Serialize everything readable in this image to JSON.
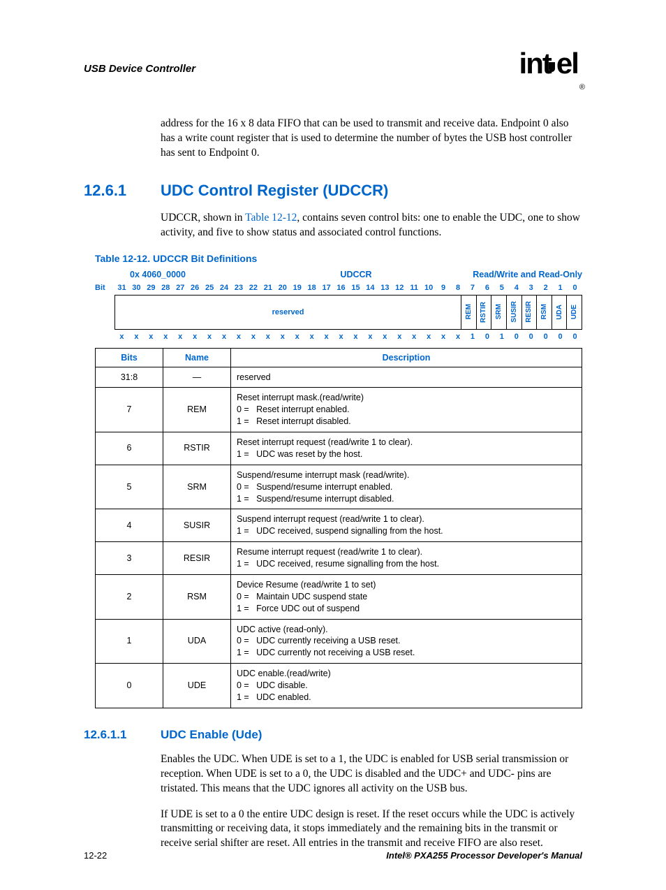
{
  "running_head": "USB Device Controller",
  "logo_text": "intel",
  "intro_para": "address for the 16 x 8 data FIFO that can be used to transmit and receive data. Endpoint 0 also has a write count register that is used to determine the number of bytes the USB host controller has sent to Endpoint 0.",
  "sec": {
    "num": "12.6.1",
    "title": "UDC Control Register (UDCCR)",
    "para_a": "UDCCR, shown in ",
    "para_link": "Table 12-12",
    "para_b": ", contains seven control bits: one to enable the UDC, one to show activity, and five to show status and associated control functions."
  },
  "table_caption": "Table 12-12. UDCCR Bit Definitions",
  "reg": {
    "addr": "0x 4060_0000",
    "name": "UDCCR",
    "access": "Read/Write and Read-Only",
    "bit_label": "Bit",
    "bits": [
      "31",
      "30",
      "29",
      "28",
      "27",
      "26",
      "25",
      "24",
      "23",
      "22",
      "21",
      "20",
      "19",
      "18",
      "17",
      "16",
      "15",
      "14",
      "13",
      "12",
      "11",
      "10",
      "9",
      "8",
      "7",
      "6",
      "5",
      "4",
      "3",
      "2",
      "1",
      "0"
    ],
    "reserved_label": "reserved",
    "fields": [
      "REM",
      "RSTIR",
      "SRM",
      "SUSIR",
      "RESIR",
      "RSM",
      "UDA",
      "UDE"
    ],
    "reset": [
      "x",
      "x",
      "x",
      "x",
      "x",
      "x",
      "x",
      "x",
      "x",
      "x",
      "x",
      "x",
      "x",
      "x",
      "x",
      "x",
      "x",
      "x",
      "x",
      "x",
      "x",
      "x",
      "x",
      "x",
      "1",
      "0",
      "1",
      "0",
      "0",
      "0",
      "0",
      "0"
    ]
  },
  "cols": {
    "bits": "Bits",
    "name": "Name",
    "desc": "Description"
  },
  "rows": [
    {
      "bits": "31:8",
      "name": "—",
      "desc_lines": [
        "reserved"
      ]
    },
    {
      "bits": "7",
      "name": "REM",
      "desc_lines": [
        "Reset interrupt mask.(read/write)",
        "0 =   Reset interrupt enabled.",
        "1 =   Reset interrupt disabled."
      ]
    },
    {
      "bits": "6",
      "name": "RSTIR",
      "desc_lines": [
        "Reset interrupt request (read/write 1 to clear).",
        "1 =   UDC was reset by the host."
      ]
    },
    {
      "bits": "5",
      "name": "SRM",
      "desc_lines": [
        "Suspend/resume interrupt mask (read/write).",
        "0 =   Suspend/resume interrupt enabled.",
        "1 =   Suspend/resume interrupt disabled."
      ]
    },
    {
      "bits": "4",
      "name": "SUSIR",
      "desc_lines": [
        "Suspend interrupt request (read/write 1 to clear).",
        "1 =   UDC received, suspend signalling from the host."
      ]
    },
    {
      "bits": "3",
      "name": "RESIR",
      "desc_lines": [
        "Resume interrupt request (read/write 1 to clear).",
        "1 =   UDC received, resume signalling from the host."
      ]
    },
    {
      "bits": "2",
      "name": "RSM",
      "desc_lines": [
        "Device Resume (read/write 1 to set)",
        "0 =   Maintain UDC suspend state",
        "1 =   Force UDC out of suspend"
      ]
    },
    {
      "bits": "1",
      "name": "UDA",
      "desc_lines": [
        "UDC active (read-only).",
        "0 =   UDC currently receiving a USB reset.",
        "1 =   UDC currently not receiving a USB reset."
      ]
    },
    {
      "bits": "0",
      "name": "UDE",
      "desc_lines": [
        "UDC enable.(read/write)",
        "0 =   UDC disable.",
        "1 =   UDC enabled."
      ]
    }
  ],
  "sub": {
    "num": "12.6.1.1",
    "title": "UDC Enable (Ude)",
    "p1": "Enables the UDC. When UDE is set to a 1, the UDC is enabled for USB serial transmission or reception. When UDE is set to a 0, the UDC is disabled and the UDC+ and UDC- pins are tristated. This means that the UDC ignores all activity on the USB bus.",
    "p2": "If UDE is set to a 0 the entire UDC design is reset. If the reset occurs while the UDC is actively transmitting or receiving data, it stops immediately and the remaining bits in the transmit or receive serial shifter are reset. All entries in the transmit and receive FIFO are also reset."
  },
  "footer": {
    "page": "12-22",
    "manual": "Intel® PXA255 Processor Developer's Manual"
  },
  "chart_data": {
    "type": "table",
    "title": "UDCCR Bit Definitions",
    "register_address": "0x4060_0000",
    "register_name": "UDCCR",
    "access": "Read/Write and Read-Only",
    "bit_fields": [
      {
        "bits": "31:8",
        "name": "reserved",
        "reset": "x"
      },
      {
        "bits": "7",
        "name": "REM",
        "reset": 1
      },
      {
        "bits": "6",
        "name": "RSTIR",
        "reset": 0
      },
      {
        "bits": "5",
        "name": "SRM",
        "reset": 1
      },
      {
        "bits": "4",
        "name": "SUSIR",
        "reset": 0
      },
      {
        "bits": "3",
        "name": "RESIR",
        "reset": 0
      },
      {
        "bits": "2",
        "name": "RSM",
        "reset": 0
      },
      {
        "bits": "1",
        "name": "UDA",
        "reset": 0
      },
      {
        "bits": "0",
        "name": "UDE",
        "reset": 0
      }
    ]
  }
}
